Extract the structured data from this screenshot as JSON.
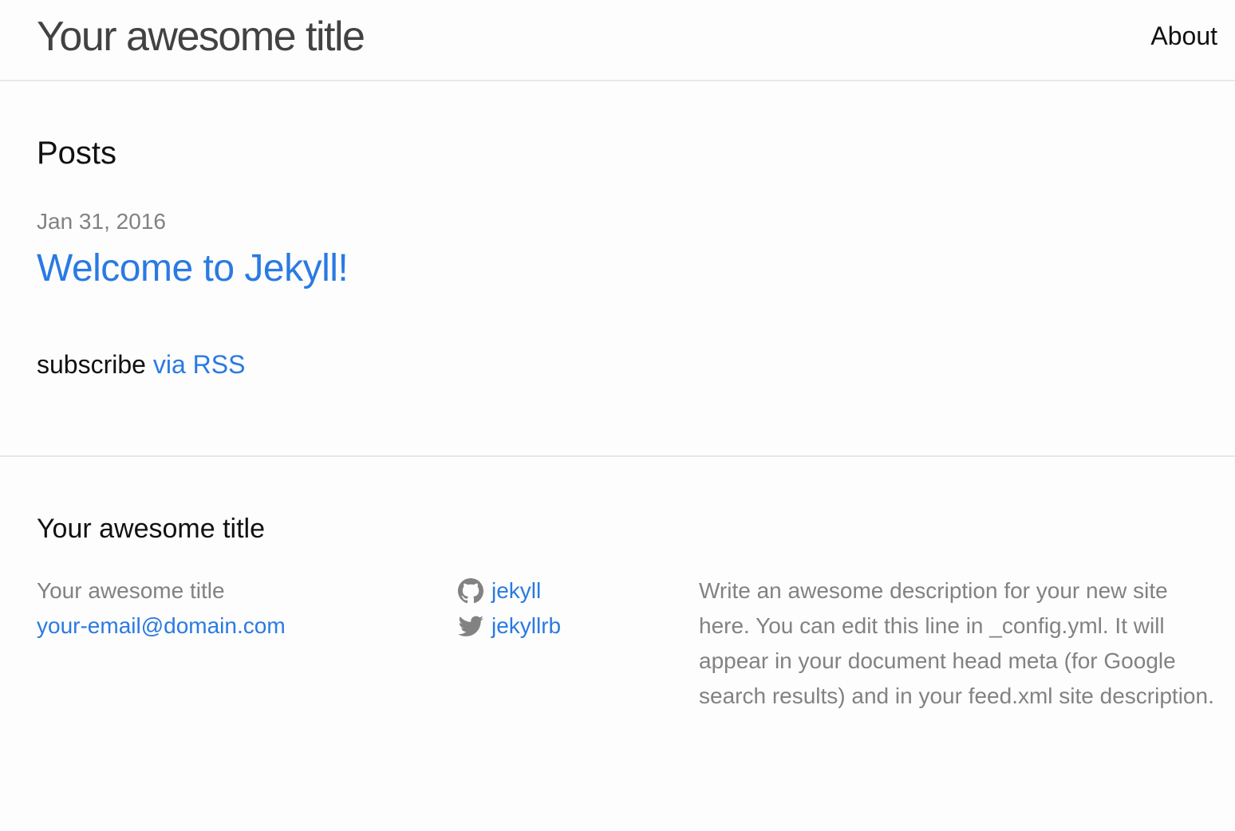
{
  "header": {
    "site_title": "Your awesome title",
    "nav": [
      {
        "label": "About"
      }
    ]
  },
  "main": {
    "heading": "Posts",
    "posts": [
      {
        "date": "Jan 31, 2016",
        "title": "Welcome to Jekyll!"
      }
    ],
    "rss_prefix": "subscribe",
    "rss_link": "via RSS"
  },
  "footer": {
    "heading": "Your awesome title",
    "name": "Your awesome title",
    "email": "your-email@domain.com",
    "social": [
      {
        "icon": "github-icon",
        "username": "jekyll"
      },
      {
        "icon": "twitter-icon",
        "username": "jekyllrb"
      }
    ],
    "description": "Write an awesome description for your new site here. You can edit this line in _config.yml. It will appear in your document head meta (for Google search results) and in your feed.xml site description."
  },
  "colors": {
    "link": "#2a7ae2",
    "text": "#111111",
    "muted": "#828282",
    "border": "#e8e8e8",
    "background": "#fdfdfd"
  }
}
